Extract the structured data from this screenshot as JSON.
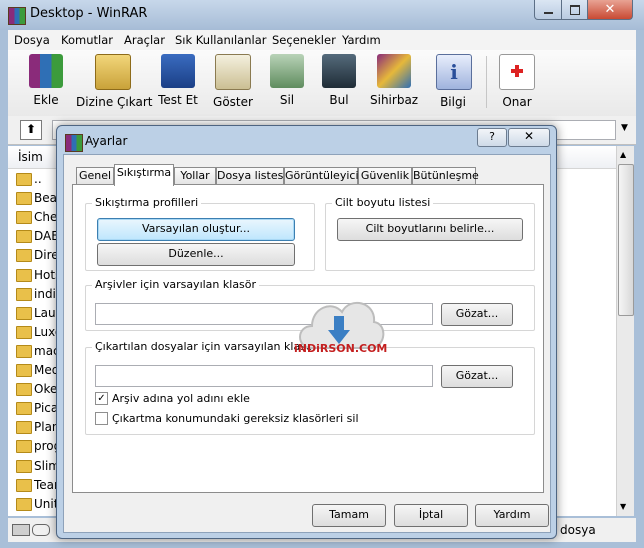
{
  "main": {
    "title": "Desktop - WinRAR",
    "menu": [
      "Dosya",
      "Komutlar",
      "Araçlar",
      "Sık Kullanılanlar",
      "Seçenekler",
      "Yardım"
    ],
    "toolbar": [
      "Ekle",
      "Dizine Çıkart",
      "Test Et",
      "Göster",
      "Sil",
      "Bul",
      "Sihirbaz",
      "Bilgi",
      "Onar"
    ],
    "column_name": "İsim",
    "files": [
      "..",
      "Bear",
      "Chea",
      "DAEI",
      "Dire",
      "Hots",
      "indir",
      "Laur",
      "Luxo",
      "mac",
      "Med",
      "Okey",
      "Pica",
      "Plan",
      "prog",
      "Slim",
      "Tear",
      "Unity"
    ],
    "status_right": "dosya"
  },
  "dialog": {
    "title": "Ayarlar",
    "help": "?",
    "tabs": [
      "Genel",
      "Sıkıştırma",
      "Yollar",
      "Dosya listesi",
      "Görüntüleyici",
      "Güvenlik",
      "Bütünleşme"
    ],
    "active_tab": "Sıkıştırma",
    "profiles_group": "Sıkıştırma profilleri",
    "create_default": "Varsayılan oluştur...",
    "edit": "Düzenle...",
    "volume_group": "Cilt boyutu listesi",
    "define_volume": "Cilt boyutlarını belirle...",
    "archive_folder_label": "Arşivler için varsayılan klasör",
    "archive_folder_value": "",
    "browse": "Gözat...",
    "extract_folder_label": "Çıkartılan dosyalar için varsayılan klasör",
    "extract_folder_value": "",
    "browse2": "Gözat...",
    "check1": "Arşiv adına yol adını ekle",
    "check1_checked": true,
    "check2": "Çıkartma konumundaki gereksiz klasörleri sil",
    "check2_checked": false,
    "ok": "Tamam",
    "cancel": "İptal",
    "helpbtn": "Yardım"
  },
  "watermark": "iNDiRSON.COM"
}
